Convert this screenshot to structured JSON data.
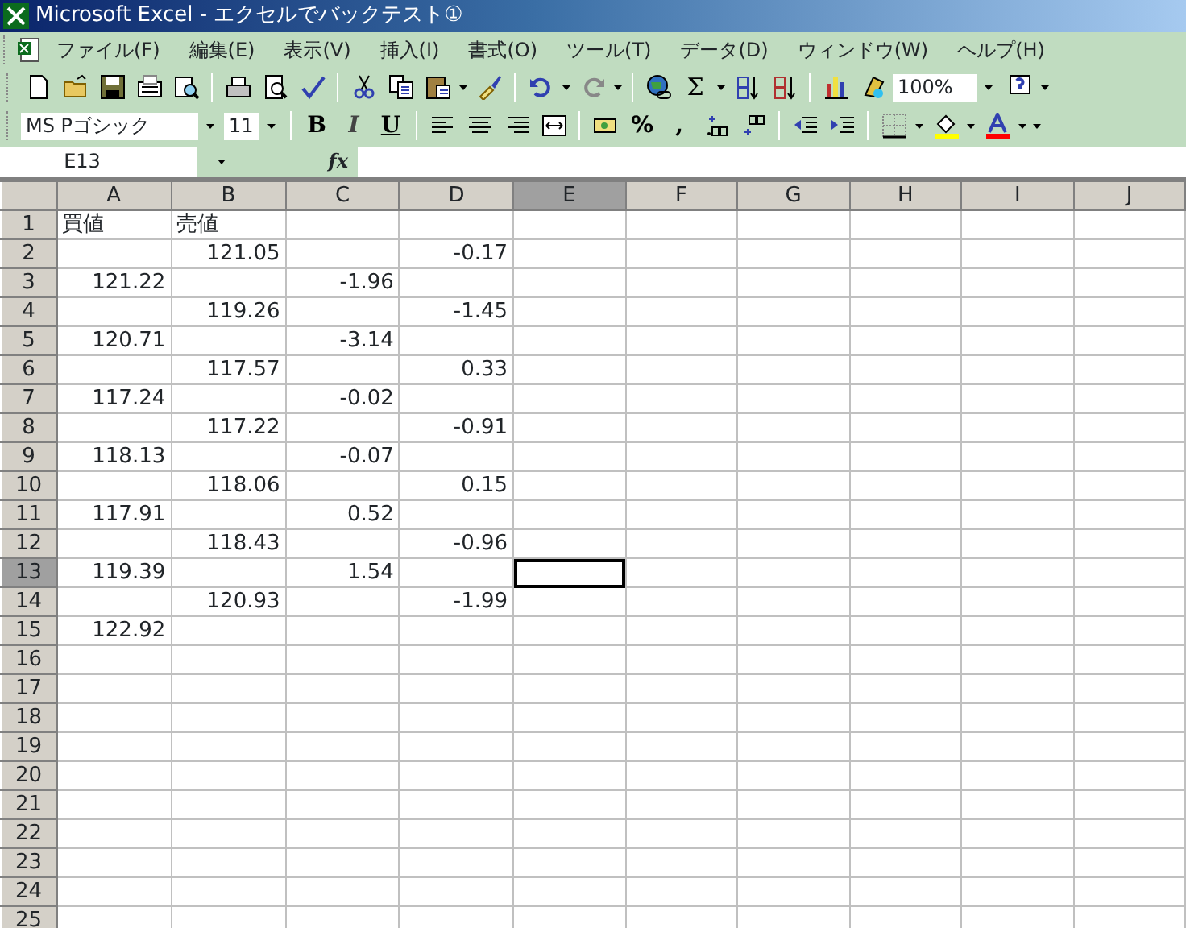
{
  "window": {
    "title": "Microsoft Excel - エクセルでバックテスト①"
  },
  "menu": [
    "ファイル(F)",
    "編集(E)",
    "表示(V)",
    "挿入(I)",
    "書式(O)",
    "ツール(T)",
    "データ(D)",
    "ウィンドウ(W)",
    "ヘルプ(H)"
  ],
  "standard_toolbar": {
    "autosum": "Σ",
    "zoom": "100%"
  },
  "formatting_toolbar": {
    "font": "MS Pゴシック",
    "size": "11",
    "bold": "B",
    "italic": "I",
    "underline": "U",
    "percent": "%",
    "comma": ","
  },
  "formula_bar": {
    "name_box": "E13",
    "fx": "fx"
  },
  "columns": [
    {
      "label": "A",
      "selected": false
    },
    {
      "label": "B",
      "selected": false
    },
    {
      "label": "C",
      "selected": false
    },
    {
      "label": "D",
      "selected": false
    },
    {
      "label": "E",
      "selected": true
    },
    {
      "label": "F",
      "selected": false
    },
    {
      "label": "G",
      "selected": false
    },
    {
      "label": "H",
      "selected": false
    },
    {
      "label": "I",
      "selected": false
    },
    {
      "label": "J",
      "selected": false
    }
  ],
  "rows": [
    {
      "number": "1",
      "selected": false,
      "kind": "label",
      "cells": [
        "買値",
        "売値",
        null,
        null
      ]
    },
    {
      "number": "2",
      "selected": false,
      "kind": "data",
      "cells": [
        null,
        "121.05",
        null,
        "-0.17"
      ]
    },
    {
      "number": "3",
      "selected": false,
      "kind": "data",
      "cells": [
        "121.22",
        null,
        "-1.96",
        null
      ]
    },
    {
      "number": "4",
      "selected": false,
      "kind": "data",
      "cells": [
        null,
        "119.26",
        null,
        "-1.45"
      ]
    },
    {
      "number": "5",
      "selected": false,
      "kind": "data",
      "cells": [
        "120.71",
        null,
        "-3.14",
        null
      ]
    },
    {
      "number": "6",
      "selected": false,
      "kind": "data",
      "cells": [
        null,
        "117.57",
        null,
        "0.33"
      ]
    },
    {
      "number": "7",
      "selected": false,
      "kind": "data",
      "cells": [
        "117.24",
        null,
        "-0.02",
        null
      ]
    },
    {
      "number": "8",
      "selected": false,
      "kind": "data",
      "cells": [
        null,
        "117.22",
        null,
        "-0.91"
      ]
    },
    {
      "number": "9",
      "selected": false,
      "kind": "data",
      "cells": [
        "118.13",
        null,
        "-0.07",
        null
      ]
    },
    {
      "number": "10",
      "selected": false,
      "kind": "data",
      "cells": [
        null,
        "118.06",
        null,
        "0.15"
      ]
    },
    {
      "number": "11",
      "selected": false,
      "kind": "data",
      "cells": [
        "117.91",
        null,
        "0.52",
        null
      ]
    },
    {
      "number": "12",
      "selected": false,
      "kind": "data",
      "cells": [
        null,
        "118.43",
        null,
        "-0.96"
      ]
    },
    {
      "number": "13",
      "selected": true,
      "kind": "data",
      "cells": [
        "119.39",
        null,
        "1.54",
        null
      ]
    },
    {
      "number": "14",
      "selected": false,
      "kind": "data",
      "cells": [
        null,
        "120.93",
        null,
        "-1.99"
      ]
    },
    {
      "number": "15",
      "selected": false,
      "kind": "data",
      "cells": [
        "122.92"
      ]
    },
    {
      "number": "16",
      "selected": false
    },
    {
      "number": "17",
      "selected": false
    },
    {
      "number": "18",
      "selected": false
    },
    {
      "number": "19",
      "selected": false
    },
    {
      "number": "20",
      "selected": false
    },
    {
      "number": "21",
      "selected": false
    },
    {
      "number": "22",
      "selected": false
    },
    {
      "number": "23",
      "selected": false
    },
    {
      "number": "24",
      "selected": false
    },
    {
      "number": "25",
      "selected": false
    }
  ]
}
